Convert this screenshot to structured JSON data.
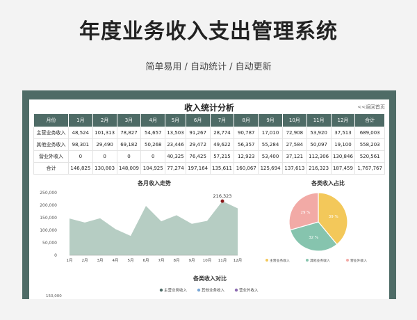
{
  "hero": {
    "title": "年度业务收入支出管理系统",
    "subtitle": "简单易用 / 自动统计 / 自动更新"
  },
  "sheet": {
    "title": "收入统计分析",
    "back_link": "<<返回首页"
  },
  "table": {
    "headers": [
      "月份",
      "1月",
      "2月",
      "3月",
      "4月",
      "5月",
      "6月",
      "7月",
      "8月",
      "9月",
      "10月",
      "11月",
      "12月",
      "合计"
    ],
    "rows": [
      [
        "主营业务收入",
        "48,524",
        "101,313",
        "78,827",
        "54,657",
        "13,503",
        "91,267",
        "28,774",
        "90,787",
        "17,010",
        "72,908",
        "53,920",
        "37,513",
        "689,003"
      ],
      [
        "其他业务收入",
        "98,301",
        "29,490",
        "69,182",
        "50,268",
        "23,446",
        "29,472",
        "49,622",
        "56,357",
        "55,284",
        "27,584",
        "50,097",
        "19,100",
        "558,203"
      ],
      [
        "营业外收入",
        "0",
        "0",
        "0",
        "0",
        "40,325",
        "76,425",
        "57,215",
        "12,923",
        "53,400",
        "37,121",
        "112,306",
        "130,846",
        "520,561"
      ],
      [
        "合计",
        "146,825",
        "130,803",
        "148,009",
        "104,925",
        "77,274",
        "197,164",
        "135,611",
        "160,067",
        "125,694",
        "137,613",
        "216,323",
        "187,459",
        "1,767,767"
      ]
    ]
  },
  "chart_data": [
    {
      "type": "area",
      "title": "各月收入走势",
      "categories": [
        "1月",
        "2月",
        "3月",
        "4月",
        "5月",
        "6月",
        "7月",
        "8月",
        "9月",
        "10月",
        "11月",
        "12月"
      ],
      "values": [
        146825,
        130803,
        148009,
        104925,
        77274,
        197164,
        135611,
        160067,
        125694,
        137613,
        216323,
        187459
      ],
      "ylim": [
        0,
        250000
      ],
      "yticks": [
        "250,000",
        "200,000",
        "150,000",
        "100,000",
        "50,000",
        "0"
      ],
      "highlight_label": "216,323",
      "fill_color": "#a9c4b8"
    },
    {
      "type": "pie",
      "title": "各类收入占比",
      "series": [
        {
          "name": "主营业务收入",
          "value": 689003,
          "label": "39 %",
          "color": "#f3c85a"
        },
        {
          "name": "其他业务收入",
          "value": 558203,
          "label": "32 %",
          "color": "#86c4ae"
        },
        {
          "name": "营业外收入",
          "value": 520561,
          "label": "29 %",
          "color": "#f2aaa6"
        }
      ]
    },
    {
      "type": "bar",
      "title": "各类收入对比",
      "legend": [
        "主营业务收入",
        "其他业务收入",
        "营业外收入"
      ],
      "legend_colors": [
        "#4e6b66",
        "#7aa7d6",
        "#8c6bb1"
      ],
      "visible_ytick": "150,000"
    }
  ]
}
